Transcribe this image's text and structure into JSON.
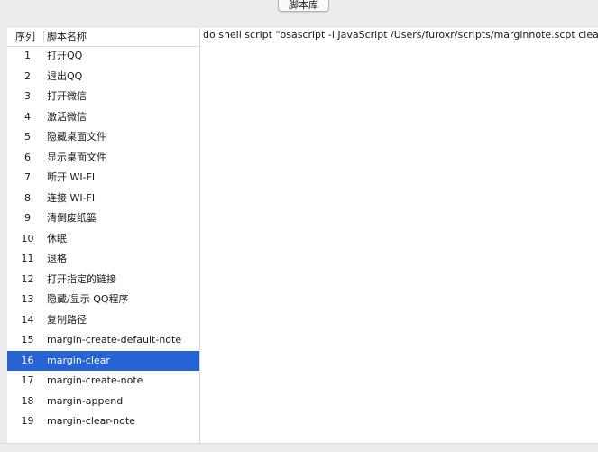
{
  "toolbar": {
    "tab_label": "脚本库"
  },
  "list": {
    "columns": {
      "index": "序列",
      "name": "脚本名称"
    },
    "selected_index": 15,
    "items": [
      {
        "index": "1",
        "name": "打开QQ"
      },
      {
        "index": "2",
        "name": "退出QQ"
      },
      {
        "index": "3",
        "name": "打开微信"
      },
      {
        "index": "4",
        "name": "激活微信"
      },
      {
        "index": "5",
        "name": "隐藏桌面文件"
      },
      {
        "index": "6",
        "name": "显示桌面文件"
      },
      {
        "index": "7",
        "name": "断开 WI-FI"
      },
      {
        "index": "8",
        "name": "连接 WI-FI"
      },
      {
        "index": "9",
        "name": "清倒废纸篓"
      },
      {
        "index": "10",
        "name": "休眠"
      },
      {
        "index": "11",
        "name": "退格"
      },
      {
        "index": "12",
        "name": "打开指定的链接"
      },
      {
        "index": "13",
        "name": "隐藏/显示 QQ程序"
      },
      {
        "index": "14",
        "name": "复制路径"
      },
      {
        "index": "15",
        "name": "margin-create-default-note"
      },
      {
        "index": "16",
        "name": "margin-clear"
      },
      {
        "index": "17",
        "name": "margin-create-note"
      },
      {
        "index": "18",
        "name": "margin-append"
      },
      {
        "index": "19",
        "name": "margin-clear-note"
      }
    ]
  },
  "editor": {
    "content": "do shell script \"osascript -l JavaScript  /Users/furoxr/scripts/marginnote.scpt clear\""
  },
  "colors": {
    "selection": "#2563d6",
    "background": "#ececec"
  }
}
